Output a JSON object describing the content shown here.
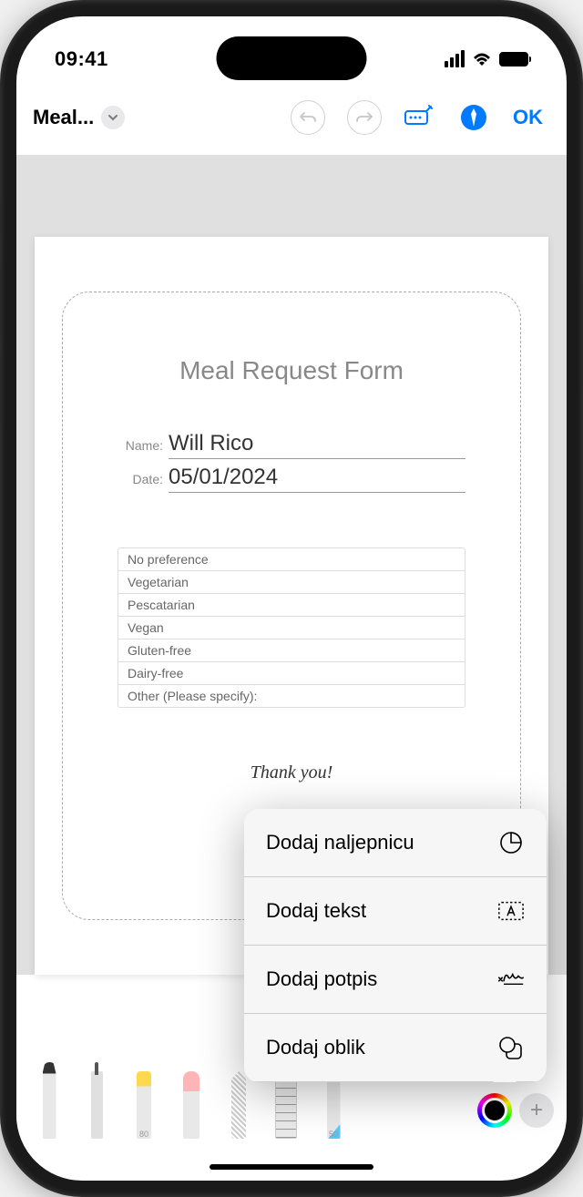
{
  "status": {
    "time": "09:41"
  },
  "toolbar": {
    "title": "Meal...",
    "ok_label": "OK"
  },
  "document": {
    "form_title": "Meal Request Form",
    "name_label": "Name:",
    "name_value": "Will Rico",
    "date_label": "Date:",
    "date_value": "05/01/2024",
    "options": [
      "No preference",
      "Vegetarian",
      "Pescatarian",
      "Vegan",
      "Gluten-free",
      "Dairy-free",
      "Other (Please specify):"
    ],
    "thanks": "Thank you!"
  },
  "popup": {
    "add_sticker": "Dodaj naljepnicu",
    "add_text": "Dodaj tekst",
    "add_signature": "Dodaj potpis",
    "add_shape": "Dodaj oblik"
  },
  "tools": {
    "highlighter_label": "80",
    "pencil_label": "50"
  }
}
